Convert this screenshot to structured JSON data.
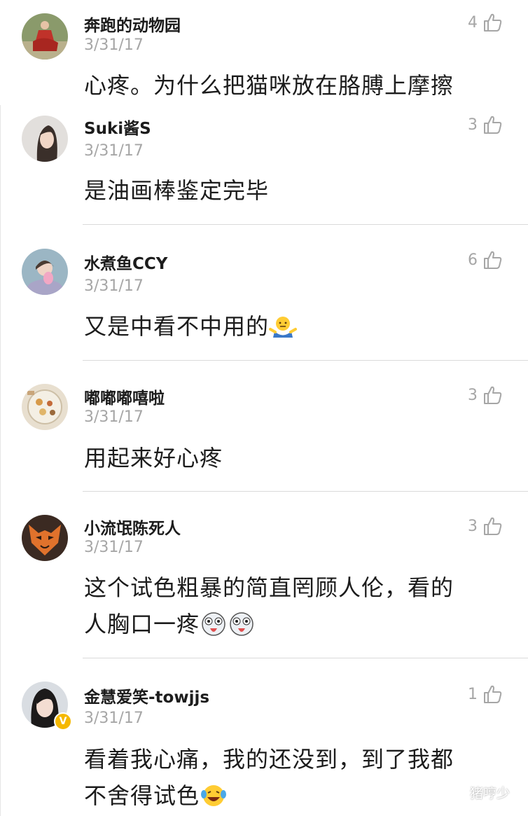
{
  "comments": [
    {
      "username": "奔跑的动物园",
      "date": "3/31/17",
      "likes": "4",
      "text": "心疼。为什么把猫咪放在胳膊上摩擦",
      "avatar": "red-dress-portrait"
    },
    {
      "username": "Suki酱S",
      "date": "3/31/17",
      "likes": "3",
      "text": "是油画棒鉴定完毕",
      "avatar": "girl-selfie"
    },
    {
      "username": "水煮鱼CCY",
      "date": "3/31/17",
      "likes": "6",
      "text": "又是中看不中用的",
      "emoji": "shrug-emoji",
      "avatar": "girl-pink-cup"
    },
    {
      "username": "嘟嘟嘟嘻啦",
      "date": "3/31/17",
      "likes": "3",
      "text": "用起来好心疼",
      "avatar": "food-plate"
    },
    {
      "username": "小流氓陈死人",
      "date": "3/31/17",
      "likes": "3",
      "text_line1": "这个试色粗暴的简直罔顾人伦，看的",
      "text_line2": "人胸口一疼",
      "emoji": "husky-emoji",
      "avatar": "fox-mask"
    },
    {
      "username": "金慧爱笑-towjjs",
      "date": "3/31/17",
      "likes": "1",
      "text_line1": "看着我心痛，我的还没到，到了我都",
      "text_line2": "不舍得试色",
      "emoji": "laughing-tears-emoji",
      "avatar": "verified-girl",
      "verified_badge": "V"
    }
  ],
  "watermark": "猪哼少",
  "colors": {
    "meta": "#a6a6a6",
    "divider": "#dadada",
    "text": "#1c1c1c",
    "verified": "#f5b800"
  }
}
